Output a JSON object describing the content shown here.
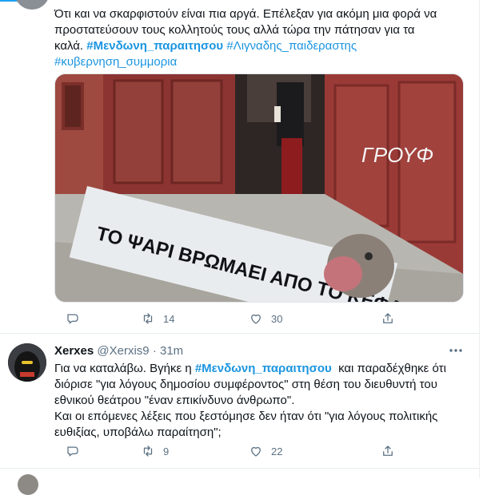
{
  "tweet1": {
    "line1": "Ότι και να σκαρφιστούν είναι πια αργά. Επέλεξαν για ακόμη μια φορά να",
    "line2": "προστατεύσουν τους κολλητούς τους αλλά τώρα την πάτησαν για τα",
    "line3_text": "καλά. ",
    "hashtag1": "#Μενδωνη_παραιτησου",
    "hashtag2": "#Λιγναδης_παιδεραστης",
    "hashtag3": "#κυβερνηση_συμμορια",
    "banner_text": "ΤΟ ΨΑΡΙ ΒΡΩΜΑΕΙ ΑΠΟ ΤΟ ΚΕΦΑΛΙ",
    "graffiti_text": "ΓΡΟΥΦ",
    "retweets": "14",
    "likes": "30"
  },
  "tweet2": {
    "display_name": "Xerxes",
    "handle": "@Xerxis9",
    "separator": "·",
    "time": "31m",
    "l1_pre": "Για να καταλάβω. Βγήκε η ",
    "l1_tag": "#Μενδωνη_παραιτησου",
    "l1_post": "  και παραδέχθηκε ότι",
    "l2": "διόρισε \"για λόγους δημοσίου συμφέροντος\" στη θέση του διευθυντή του",
    "l3": "εθνικού θεάτρου \"έναν επικίνδυνο άνθρωπο\".",
    "l4": "Και οι επόμενες λέξεις που ξεστόμησε δεν ήταν ότι \"για λόγους πολιτικής",
    "l5": "ευθιξίας, υποβάλω παραίτηση\";",
    "retweets": "9",
    "likes": "22"
  },
  "colors": {
    "link": "#1b95e0",
    "muted": "#5b7083",
    "text": "#0f1419",
    "divider": "#e6ecf0"
  },
  "icons": [
    "reply-icon",
    "retweet-icon",
    "like-icon",
    "share-icon",
    "more-icon"
  ]
}
